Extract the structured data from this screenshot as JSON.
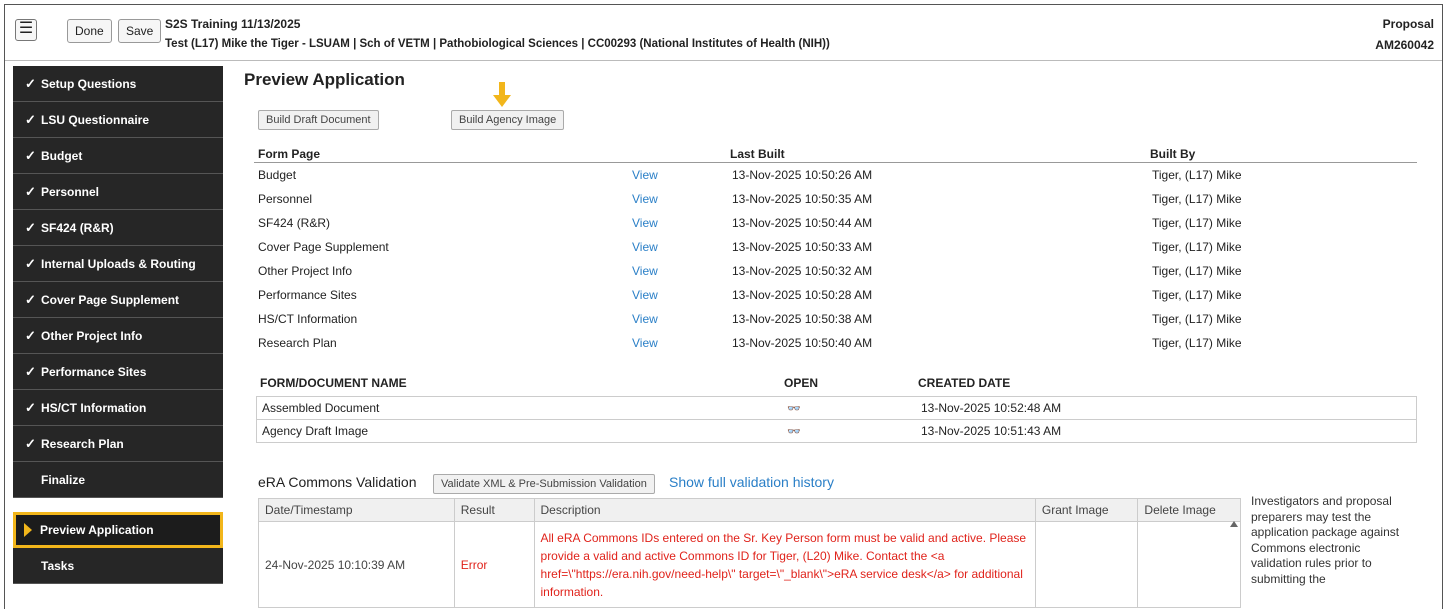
{
  "header": {
    "done_label": "Done",
    "save_label": "Save",
    "title": "S2S Training 11/13/2025",
    "subtitle": "Test (L17) Mike the Tiger - LSUAM | Sch of VETM | Pathobiological Sciences | CC00293 (National Institutes of Health (NIH))",
    "type": "Proposal",
    "number": "AM260042"
  },
  "sidebar": {
    "items": [
      {
        "label": "Setup Questions"
      },
      {
        "label": "LSU Questionnaire"
      },
      {
        "label": "Budget"
      },
      {
        "label": "Personnel"
      },
      {
        "label": "SF424 (R&R)"
      },
      {
        "label": "Internal Uploads & Routing"
      },
      {
        "label": "Cover Page Supplement"
      },
      {
        "label": "Other Project Info"
      },
      {
        "label": "Performance Sites"
      },
      {
        "label": "HS/CT Information"
      },
      {
        "label": "Research Plan"
      },
      {
        "label": "Finalize"
      }
    ],
    "active_label": "Preview Application",
    "tasks_label": "Tasks",
    "checkmark": "✓"
  },
  "main": {
    "title": "Preview Application",
    "build_draft_label": "Build Draft Document",
    "build_agency_label": "Build Agency Image",
    "forms_headers": {
      "form_page": "Form Page",
      "last_built": "Last Built",
      "built_by": "Built By"
    },
    "view_label": "View",
    "forms": [
      {
        "page": "Budget",
        "last_built": "13-Nov-2025 10:50:26 AM",
        "built_by": "Tiger, (L17) Mike"
      },
      {
        "page": "Personnel",
        "last_built": "13-Nov-2025 10:50:35 AM",
        "built_by": "Tiger, (L17) Mike"
      },
      {
        "page": "SF424 (R&R)",
        "last_built": "13-Nov-2025 10:50:44 AM",
        "built_by": "Tiger, (L17) Mike"
      },
      {
        "page": "Cover Page Supplement",
        "last_built": "13-Nov-2025 10:50:33 AM",
        "built_by": "Tiger, (L17) Mike"
      },
      {
        "page": "Other Project Info",
        "last_built": "13-Nov-2025 10:50:32 AM",
        "built_by": "Tiger, (L17) Mike"
      },
      {
        "page": "Performance Sites",
        "last_built": "13-Nov-2025 10:50:28 AM",
        "built_by": "Tiger, (L17) Mike"
      },
      {
        "page": "HS/CT Information",
        "last_built": "13-Nov-2025 10:50:38 AM",
        "built_by": "Tiger, (L17) Mike"
      },
      {
        "page": "Research Plan",
        "last_built": "13-Nov-2025 10:50:40 AM",
        "built_by": "Tiger, (L17) Mike"
      }
    ],
    "docs_headers": {
      "name": "FORM/DOCUMENT NAME",
      "open": "OPEN",
      "created": "CREATED DATE"
    },
    "docs": [
      {
        "name": "Assembled Document",
        "created": "13-Nov-2025 10:52:48 AM"
      },
      {
        "name": "Agency Draft Image",
        "created": "13-Nov-2025 10:51:43 AM"
      }
    ],
    "open_icon_glyph": "👓"
  },
  "validation": {
    "title": "eRA Commons Validation",
    "validate_label": "Validate XML & Pre-Submission Validation",
    "history_link": "Show full validation history",
    "headers": {
      "date": "Date/Timestamp",
      "result": "Result",
      "description": "Description",
      "grant": "Grant Image",
      "delete": "Delete Image"
    },
    "rows": [
      {
        "date": "24-Nov-2025 10:10:39 AM",
        "result": "Error",
        "description": "All eRA Commons IDs entered on the Sr. Key Person form must be valid and active. Please provide a valid and active Commons ID for Tiger, (L20) Mike. Contact the <a href=\\\"https://era.nih.gov/need-help\\\" target=\\\"_blank\\\">eRA service desk</a> for additional information."
      }
    ],
    "side_note": "Investigators and proposal preparers may test the application package against Commons electronic validation rules prior to submitting the"
  },
  "colors": {
    "accent_yellow": "#f2b61b",
    "link_blue": "#2a7fc7",
    "error_red": "#e0231b",
    "sidebar_dark": "#262626"
  }
}
